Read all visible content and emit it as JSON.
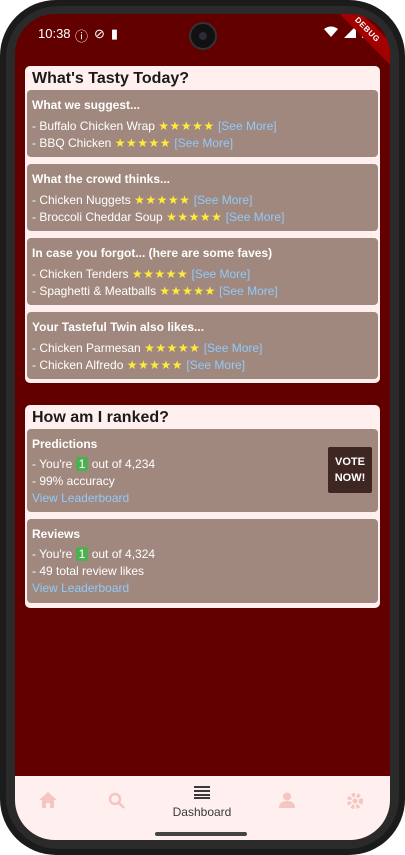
{
  "status_bar": {
    "time": "10:38"
  },
  "debug_banner": "DEBUG",
  "tasty": {
    "title": "What's Tasty Today?",
    "sections": [
      {
        "title": "What we suggest...",
        "items": [
          {
            "text": "- Buffalo Chicken Wrap",
            "stars": "★★★★★",
            "link": "[See More]"
          },
          {
            "text": "- BBQ Chicken",
            "stars": "★★★★★",
            "link": "[See More]"
          }
        ]
      },
      {
        "title": "What the crowd thinks...",
        "items": [
          {
            "text": "- Chicken Nuggets",
            "stars": "★★★★★",
            "link": "[See More]"
          },
          {
            "text": "- Broccoli Cheddar Soup",
            "stars": "★★★★★",
            "link": "[See More]"
          }
        ]
      },
      {
        "title": "In case you forgot... (here are some faves)",
        "items": [
          {
            "text": "- Chicken Tenders",
            "stars": "★★★★★",
            "link": "[See More]"
          },
          {
            "text": "- Spaghetti & Meatballs",
            "stars": "★★★★★",
            "link": "[See More]"
          }
        ]
      },
      {
        "title": "Your Tasteful Twin also likes...",
        "items": [
          {
            "text": "- Chicken Parmesan",
            "stars": "★★★★★",
            "link": "[See More]"
          },
          {
            "text": "- Chicken Alfredo",
            "stars": "★★★★★",
            "link": "[See More]"
          }
        ]
      }
    ]
  },
  "ranked": {
    "title": "How am I ranked?",
    "predictions": {
      "title": "Predictions",
      "rank_prefix": "- You're ",
      "rank": "1",
      "rank_suffix": " out of 4,234",
      "accuracy": "- 99% accuracy",
      "link": "View Leaderboard",
      "vote_button": "VOTE NOW!"
    },
    "reviews": {
      "title": "Reviews",
      "rank_prefix": "- You're ",
      "rank": "1",
      "rank_suffix": " out of 4,324",
      "likes": "- 49 total review likes",
      "link": "View Leaderboard"
    }
  },
  "nav": {
    "items": [
      {
        "icon": "home-icon",
        "label": ""
      },
      {
        "icon": "search-icon",
        "label": ""
      },
      {
        "icon": "dashboard-icon",
        "label": "Dashboard"
      },
      {
        "icon": "person-icon",
        "label": ""
      },
      {
        "icon": "settings-icon",
        "label": ""
      }
    ]
  },
  "colors": {
    "background": "#620000",
    "panel": "#fff0ef",
    "card": "#a1887f",
    "stars": "#ffeb3b",
    "link": "#90caf9",
    "badge": "#4caf50",
    "vote": "#3e2723"
  }
}
